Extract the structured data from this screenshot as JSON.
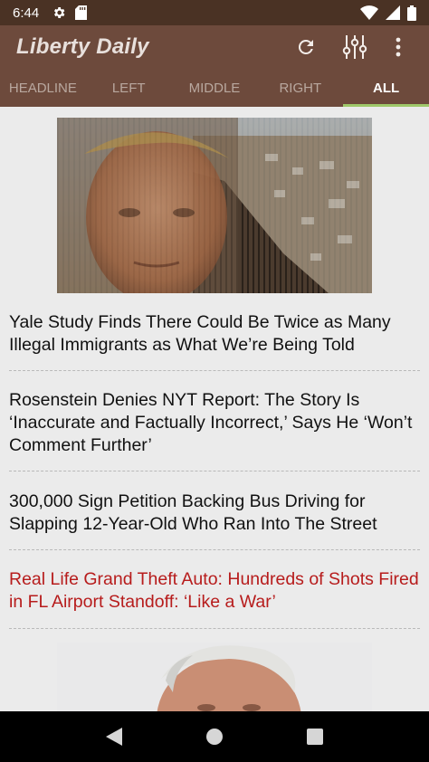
{
  "status_bar": {
    "time": "6:44",
    "icons": [
      "settings-icon",
      "sd-card-icon",
      "wifi-icon",
      "signal-icon",
      "battery-icon"
    ]
  },
  "app_bar": {
    "title": "Liberty Daily",
    "actions": [
      "refresh-icon",
      "equalizer-icon",
      "more-vert-icon"
    ]
  },
  "tabs": [
    {
      "label": "HEADLINE",
      "active": false
    },
    {
      "label": "LEFT",
      "active": false
    },
    {
      "label": "MIDDLE",
      "active": false
    },
    {
      "label": "RIGHT",
      "active": false
    },
    {
      "label": "ALL",
      "active": true
    }
  ],
  "articles": [
    {
      "headline": "Yale Study Finds There Could Be Twice as Many Illegal Immigrants as What We’re Being Told",
      "highlight": false
    },
    {
      "headline": "Rosenstein Denies NYT Report: The Story Is ‘Inaccurate and Factually Incorrect,’ Says He ‘Won’t Comment Further’",
      "highlight": false
    },
    {
      "headline": "300,000 Sign Petition Backing Bus Driving for Slapping 12-Year-Old Who Ran Into The Street",
      "highlight": false
    },
    {
      "headline": "Real Life Grand Theft Auto: Hundreds of Shots Fired in FL Airport Standoff: ‘Like a War’",
      "highlight": true
    }
  ],
  "nav_bar": {
    "buttons": [
      "back-icon",
      "home-icon",
      "recents-icon"
    ]
  },
  "colors": {
    "status_bar": "#4a3224",
    "app_bar": "#6d4a3c",
    "active_tab_indicator": "#9ec86a",
    "highlight_headline": "#b71c1c"
  }
}
